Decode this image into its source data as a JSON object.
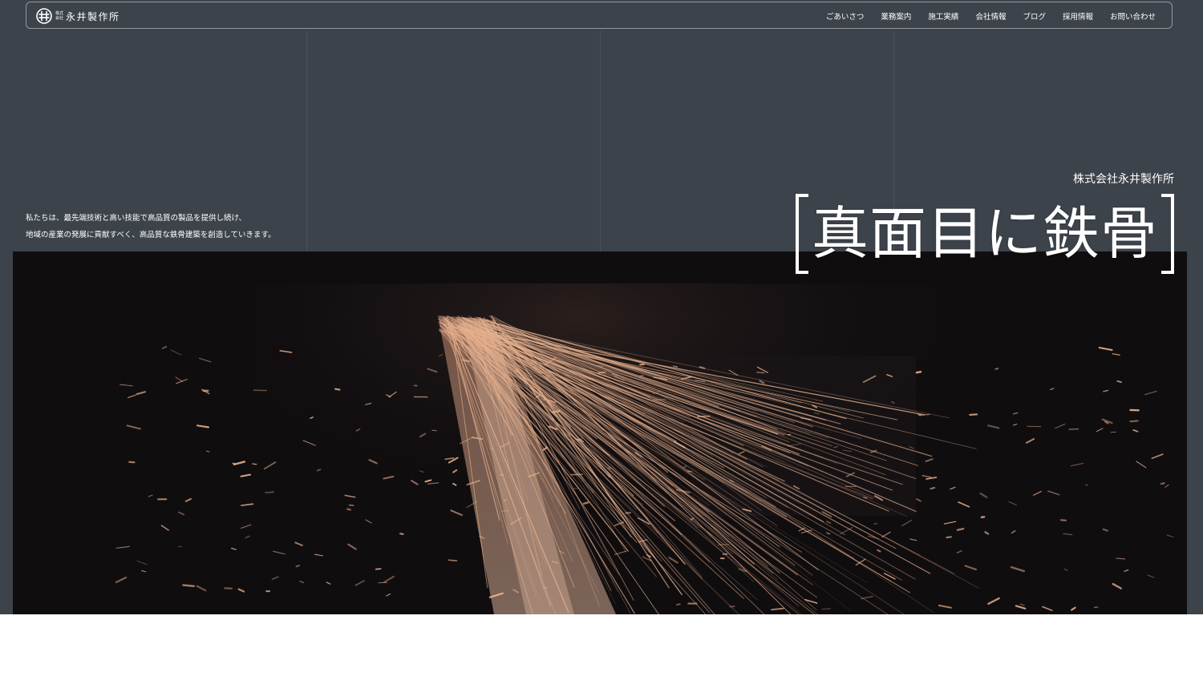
{
  "header": {
    "logo_small_top": "株式",
    "logo_small_bottom": "会社",
    "logo_name": "永井製作所"
  },
  "nav": {
    "items": [
      "ごあいさつ",
      "業務案内",
      "施工実績",
      "会社情報",
      "ブログ",
      "採用情報",
      "お問い合わせ"
    ]
  },
  "intro": {
    "line1": "私たちは、最先端技術と高い技能で高品質の製品を提供し続け、",
    "line2": "地域の産業の発展に貢献すべく、高品質な鉄骨建築を創造していきます。"
  },
  "hero": {
    "company": "株式会社永井製作所",
    "headline": "真面目に鉄骨"
  },
  "colors": {
    "background": "#3d434b",
    "video_bg": "#100d0f",
    "spark": "#e6b08e",
    "text": "#ffffff"
  },
  "video": {
    "subject": "grinding sparks"
  }
}
